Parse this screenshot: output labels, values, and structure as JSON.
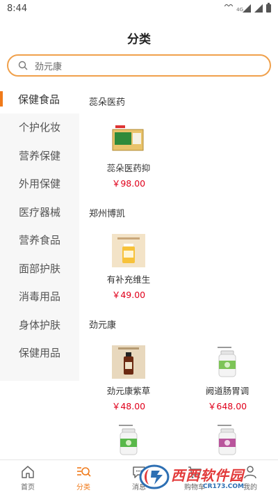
{
  "status_bar": {
    "time": "8:44",
    "network": "4G"
  },
  "header": {
    "title": "分类"
  },
  "search": {
    "value": "劲元康"
  },
  "sidebar": {
    "items": [
      {
        "label": "保健食品",
        "active": true
      },
      {
        "label": "个护化妆"
      },
      {
        "label": "营养保健"
      },
      {
        "label": "外用保健"
      },
      {
        "label": "医疗器械"
      },
      {
        "label": "营养食品"
      },
      {
        "label": "面部护肤"
      },
      {
        "label": "消毒用品"
      },
      {
        "label": "身体护肤"
      },
      {
        "label": "保健用品"
      }
    ]
  },
  "sections": [
    {
      "title": "蕊朵医药",
      "products": [
        {
          "name": "蕊朵医药抑",
          "price": "￥98.00"
        }
      ]
    },
    {
      "title": "郑州博凯",
      "products": [
        {
          "name": "有补充维生",
          "price": "￥49.00"
        }
      ]
    },
    {
      "title": "劲元康",
      "products": [
        {
          "name": "劲元康紫草",
          "price": "￥48.00"
        },
        {
          "name": "阙道肠胃调",
          "price": "￥648.00"
        }
      ]
    }
  ],
  "tabbar": {
    "items": [
      {
        "label": "首页",
        "icon": "home-icon"
      },
      {
        "label": "分类",
        "icon": "category-icon",
        "active": true
      },
      {
        "label": "消息",
        "icon": "message-icon"
      },
      {
        "label": "购物车",
        "icon": "cart-icon"
      },
      {
        "label": "我的",
        "icon": "user-icon"
      }
    ]
  },
  "watermark": {
    "brand": "西西软件园",
    "url": "CR173.COM"
  },
  "colors": {
    "accent": "#f07a1a",
    "search_border": "#f0a04b",
    "price": "#e0001b",
    "sidebar_bg": "#f7f7f7"
  }
}
